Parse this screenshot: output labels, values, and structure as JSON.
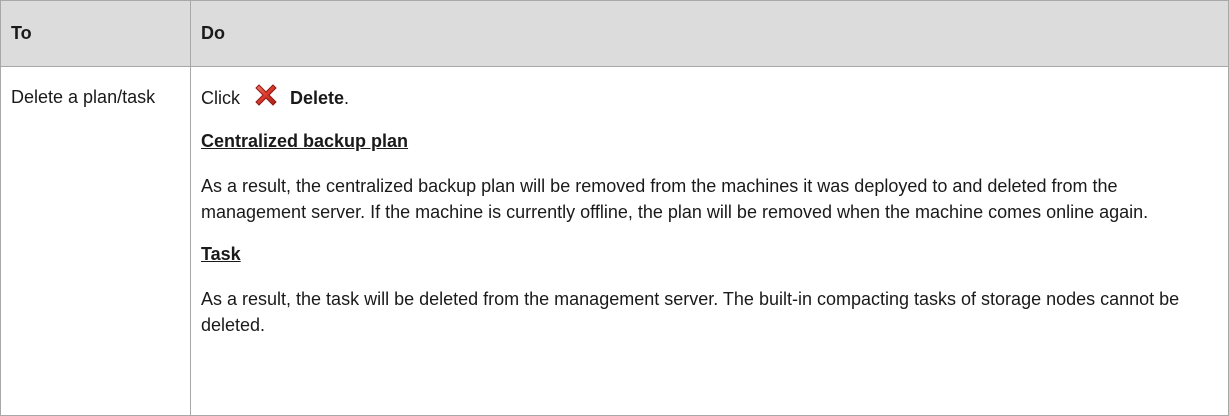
{
  "header": {
    "col_to": "To",
    "col_do": "Do"
  },
  "row": {
    "to_text": "Delete a plan/task",
    "click_word": "Click",
    "delete_icon": "red-x-delete-icon",
    "delete_label": "Delete",
    "delete_period": ".",
    "sections": [
      {
        "heading": "Centralized backup plan",
        "body": "As a result, the centralized backup plan will be removed from the machines it was deployed to and deleted from the management server. If the machine is currently offline, the plan will be removed when the machine comes online again."
      },
      {
        "heading": "Task",
        "body": "As a result, the task will be deleted from the management server. The built-in compacting tasks of storage nodes cannot be deleted."
      }
    ]
  },
  "colors": {
    "header_bg": "#dcdcdc",
    "border": "#a8a8a8",
    "icon_red": "#d9382b"
  }
}
